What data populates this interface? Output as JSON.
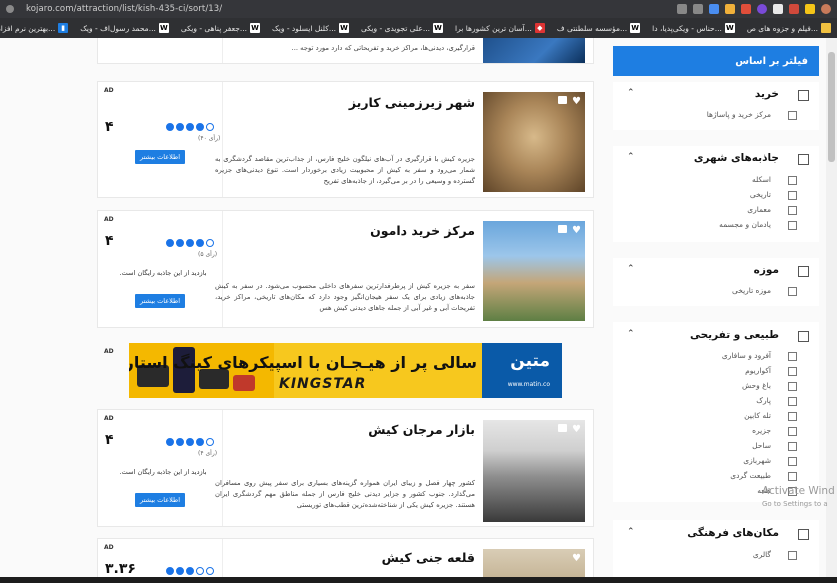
{
  "browser": {
    "url": "kojaro.com/attraction/list/kish-435-ci/sort/13/",
    "bookmarks": [
      "فیلم و جزوه های ص...",
      "حناس - ویکی‌پدیا، دا...",
      "مؤسسه سلطنتی ف...",
      "آسان ترین کشورها برا...",
      "علی تجویدی - ویکی...",
      "کلنل ایسلود - ویک...",
      "جعفر پناهی - ویکی...",
      "محمد رسول‌اف - ویک...",
      "بهترین نرم افزارهای م..."
    ]
  },
  "listings": [
    {
      "ad": "AD",
      "title": "شهر زیرزمینی کاریز",
      "score": "۴",
      "rating_count": "(۴۰ رأی)",
      "stars_filled": 5,
      "description": "جزیره کیش با قرارگیری در آب‌های نیلگون خلیج فارس، از جذاب‌ترین مقاصد گردشگری به شمار می‌رود و سفر به کیش از محبوبیت زیادی برخوردار است. تنوع دیدنی‌های جزیره گسترده و وسیعی را در بر می‌گیرد، از جاذبه‌های تفریح",
      "free_visit": "",
      "more_label": "اطلاعات بیشتر"
    },
    {
      "ad": "AD",
      "title": "مرکز خرید دامون",
      "score": "۴",
      "rating_count": "(۵ رأی)",
      "stars_filled": 5,
      "description": "سفر به جزیره کیش از پرطرفدارترین سفرهای داخلی محسوب می‌شود. در سفر به کیش جاذبه‌های زیادی برای یک سفر هیجان‌انگیز وجود دارد که مکان‌های تاریخی، مراکز خرید، تفریحات آبی و غیر آبی از جمله جاهای دیدنی کیش هس",
      "free_visit": "بازدید از این جاذبه رایگان است.",
      "more_label": "اطلاعات بیشتر"
    },
    {
      "ad": "AD",
      "title": "بازار مرجان کیش",
      "score": "۴",
      "rating_count": "(۴ رأی)",
      "stars_filled": 5,
      "description": "کشور چهار فصل و زیبای ایران همواره گزینه‌های بسیاری برای سفر پیش روی مسافران می‌گذارد. جنوب کشور و جزایر دیدنی خلیج فارس از جمله مناطق مهم گردشگری ایران هستند. جزیره کیش یکی از شناخته‌شده‌ترین قطب‌های توریستی",
      "free_visit": "بازدید از این جاذبه رایگان است.",
      "more_label": "اطلاعات بیشتر"
    },
    {
      "ad": "AD",
      "title": "قلعه جنی کیش",
      "score": "۳.۳۶",
      "rating_count": "",
      "stars_filled": 3,
      "description": "",
      "free_visit": "",
      "more_label": ""
    }
  ],
  "top_card_snippet": "قرارگیری، دیدنی‌ها، مراکز خرید و تفریحاتی که دارد مورد توجه ...",
  "banner": {
    "ad": "AD",
    "tagline": "سالی پر از هیـجـان با اسپیکرهای کینگ استار",
    "brand": "KINGSTAR",
    "matin_name": "متین",
    "matin_url": "www.matin.co"
  },
  "filters": {
    "header": "فیلتر بر اساس",
    "sections": [
      {
        "title": "خرید",
        "items": [
          "مرکز خرید و پاساژها"
        ]
      },
      {
        "title": "جاذبه‌های شهری",
        "items": [
          "اسکله",
          "تاریخی",
          "معماری",
          "یادمان و مجسمه"
        ]
      },
      {
        "title": "موزه",
        "items": [
          "موزه تاریخی"
        ]
      },
      {
        "title": "طبیعی و تفریحی",
        "items": [
          "آفرود و سافاری",
          "آکواریوم",
          "باغ وحش",
          "پارک",
          "تله کابین",
          "جزیره",
          "ساحل",
          "شهربازی",
          "طبیعت گردی",
          "قلعه"
        ]
      },
      {
        "title": "مکان‌های فرهنگی",
        "items": [
          "گالری"
        ]
      }
    ]
  },
  "watermark": {
    "line1": "Activate Wind",
    "line2": "Go to Settings to a"
  }
}
